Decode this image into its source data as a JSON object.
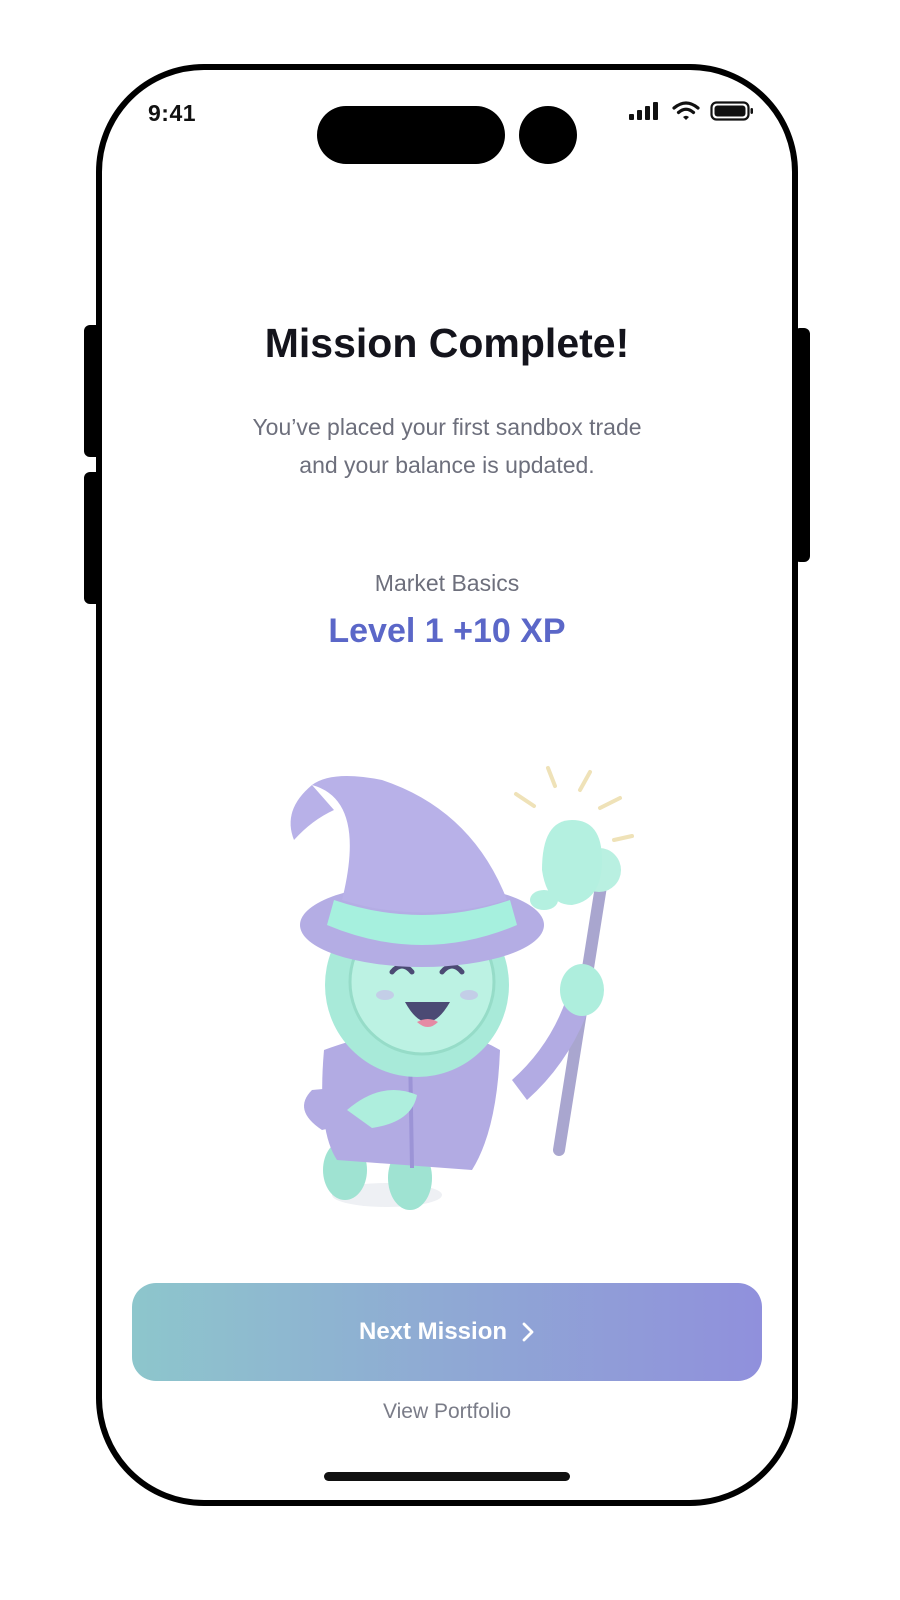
{
  "status_bar": {
    "time": "9:41",
    "icons": [
      "signal-icon",
      "wifi-icon",
      "battery-icon"
    ]
  },
  "content": {
    "title": "Mission Complete!",
    "subtitle_line1": "You’ve placed your first sandbox trade",
    "subtitle_line2": "and your balance is updated.",
    "category": "Market Basics",
    "level_reward": "Level 1 +10 XP"
  },
  "actions": {
    "primary_label": "Next Mission",
    "primary_icon": "chevron-right-icon",
    "secondary_label": "View Portfolio"
  },
  "colors": {
    "title": "#14141c",
    "muted_text": "#6d6f7c",
    "accent": "#5b67c8",
    "button_gradient_start": "#8dc6cc",
    "button_gradient_end": "#9090dc",
    "mascot_mint": "#a8ead9",
    "mascot_lavender": "#b7b2e6"
  },
  "illustration": {
    "subject": "wizard-coin-mascot-illustration"
  }
}
